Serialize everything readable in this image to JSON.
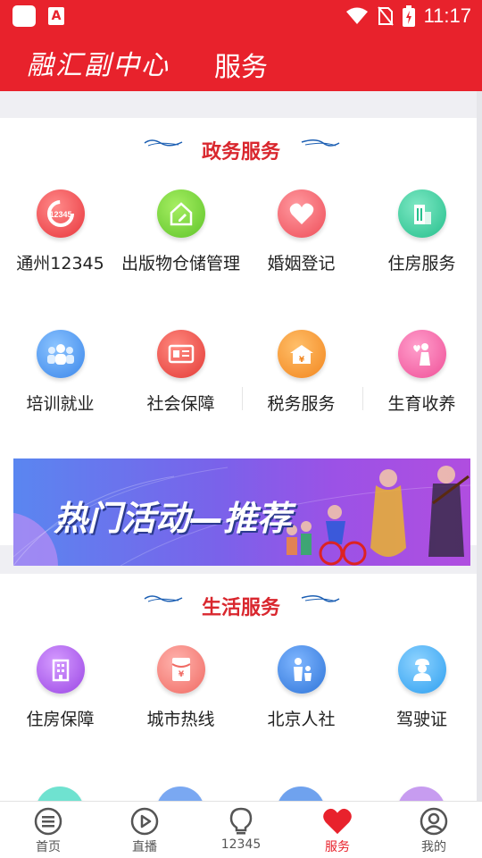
{
  "status_bar": {
    "time": "11:17"
  },
  "header": {
    "logo_text": "融汇副中心",
    "title": "服务"
  },
  "gov_section": {
    "title": "政务服务",
    "items": [
      {
        "label": "通州12345",
        "icon": "12345-hotline-icon",
        "color": "#f0555b"
      },
      {
        "label": "出版物仓储管理",
        "icon": "house-edit-icon",
        "color": "#76d23a"
      },
      {
        "label": "婚姻登记",
        "icon": "heart-icon",
        "color": "#f4606a"
      },
      {
        "label": "住房服务",
        "icon": "building-icon",
        "color": "#37c99a"
      },
      {
        "label": "培训就业",
        "icon": "people-group-icon",
        "color": "#4a9af0"
      },
      {
        "label": "社会保障",
        "icon": "id-card-icon",
        "color": "#ee4b47"
      },
      {
        "label": "税务服务",
        "icon": "tax-house-icon",
        "color": "#f7902a"
      },
      {
        "label": "生育收养",
        "icon": "mother-icon",
        "color": "#f45fa0"
      }
    ]
  },
  "banner": {
    "text": "热门活动—推荐"
  },
  "life_section": {
    "title": "生活服务",
    "items": [
      {
        "label": "住房保障",
        "icon": "apartment-icon",
        "color": "#a04fe6"
      },
      {
        "label": "城市热线",
        "icon": "red-envelope-icon",
        "color": "#f36a64"
      },
      {
        "label": "北京人社",
        "icon": "parent-child-icon",
        "color": "#3d86e6"
      },
      {
        "label": "驾驶证",
        "icon": "driver-icon",
        "color": "#3dabf0"
      }
    ]
  },
  "tabbar": {
    "tabs": [
      {
        "label": "首页",
        "icon": "menu-circle-icon"
      },
      {
        "label": "直播",
        "icon": "play-circle-icon"
      },
      {
        "label": "12345",
        "icon": "lightbulb-icon"
      },
      {
        "label": "服务",
        "icon": "heart-icon",
        "active": true
      },
      {
        "label": "我的",
        "icon": "user-icon"
      }
    ],
    "active_color": "#e8222c"
  }
}
